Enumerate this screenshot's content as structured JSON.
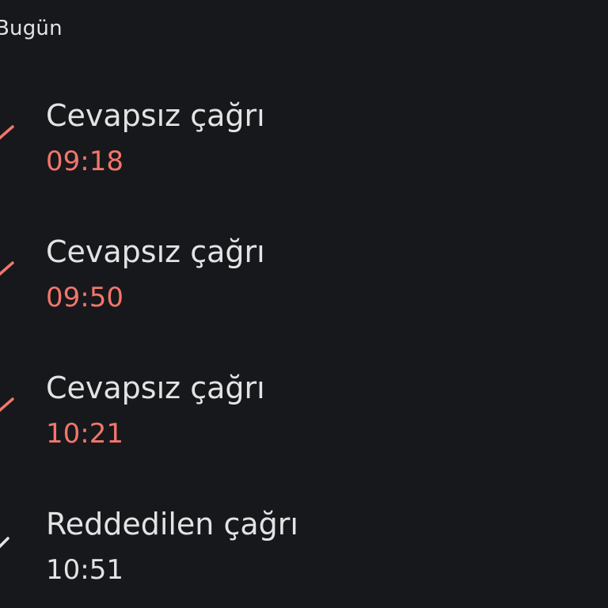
{
  "section": {
    "title": "Bugün"
  },
  "calls": [
    {
      "type": "Cevapsız çağrı",
      "time": "09:18",
      "icon": "missed-call-icon",
      "status_color": "#f2766b"
    },
    {
      "type": "Cevapsız çağrı",
      "time": "09:50",
      "icon": "missed-call-icon",
      "status_color": "#f2766b"
    },
    {
      "type": "Cevapsız çağrı",
      "time": "10:21",
      "icon": "missed-call-icon",
      "status_color": "#f2766b"
    },
    {
      "type": "Reddedilen çağrı",
      "time": "10:51",
      "icon": "declined-call-icon",
      "status_color": "#e3e3e3"
    }
  ]
}
